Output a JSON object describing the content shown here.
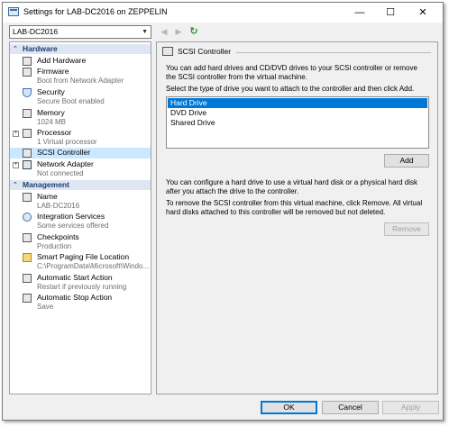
{
  "window": {
    "title": "Settings for LAB-DC2016 on ZEPPELIN",
    "controls": {
      "minimize": "—",
      "maximize": "☐",
      "close": "✕"
    }
  },
  "toolbar": {
    "vm_selector": "LAB-DC2016",
    "back": "◀",
    "forward": "▶",
    "refresh": "↻"
  },
  "sidebar": {
    "hardware_header": "Hardware",
    "management_header": "Management",
    "hardware_items": [
      {
        "label": "Add Hardware",
        "sub": ""
      },
      {
        "label": "Firmware",
        "sub": "Boot from Network Adapter"
      },
      {
        "label": "Security",
        "sub": "Secure Boot enabled"
      },
      {
        "label": "Memory",
        "sub": "1024 MB"
      },
      {
        "label": "Processor",
        "sub": "1 Virtual processor"
      },
      {
        "label": "SCSI Controller",
        "sub": ""
      },
      {
        "label": "Network Adapter",
        "sub": "Not connected"
      }
    ],
    "management_items": [
      {
        "label": "Name",
        "sub": "LAB-DC2016"
      },
      {
        "label": "Integration Services",
        "sub": "Some services offered"
      },
      {
        "label": "Checkpoints",
        "sub": "Production"
      },
      {
        "label": "Smart Paging File Location",
        "sub": "C:\\ProgramData\\Microsoft\\Windo..."
      },
      {
        "label": "Automatic Start Action",
        "sub": "Restart if previously running"
      },
      {
        "label": "Automatic Stop Action",
        "sub": "Save"
      }
    ]
  },
  "panel": {
    "title": "SCSI Controller",
    "intro": "You can add hard drives and CD/DVD drives to your SCSI controller or remove the SCSI controller from the virtual machine.",
    "instruction": "Select the type of drive you want to attach to the controller and then click Add.",
    "drive_types": [
      "Hard Drive",
      "DVD Drive",
      "Shared Drive"
    ],
    "selected_drive": "Hard Drive",
    "add_label": "Add",
    "configure_text": "You can configure a hard drive to use a virtual hard disk or a physical hard disk after you attach the drive to the controller.",
    "remove_text": "To remove the SCSI controller from this virtual machine, click Remove. All virtual hard disks attached to this controller will be removed but not deleted.",
    "remove_label": "Remove"
  },
  "footer": {
    "ok_label": "OK",
    "cancel_label": "Cancel",
    "apply_label": "Apply"
  }
}
